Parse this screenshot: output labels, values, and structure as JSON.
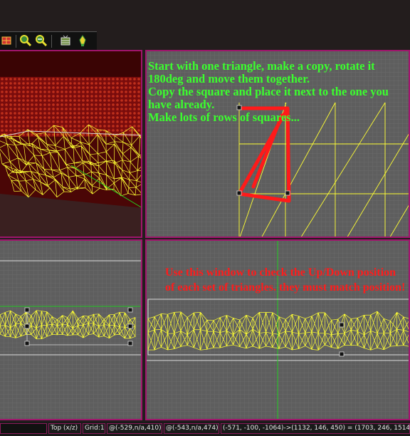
{
  "toolbar": {
    "buttons": [
      {
        "icon": "grid-tool-icon"
      },
      {
        "icon": "zoom-in-icon"
      },
      {
        "icon": "zoom-out-icon"
      },
      {
        "icon": "terrain-tool-icon"
      },
      {
        "icon": "light-bulb-icon"
      }
    ]
  },
  "viewports": {
    "top_right": {
      "instructions": "Start with one triangle, make a copy, rotate it 180deg and move them together.\nCopy the square and place it next to the one you have already.\nMake lots of rows of squares..."
    },
    "bottom_right": {
      "instructions": "Use this window to check the Up/Down position of each set of triangles. they must match position!"
    }
  },
  "statusbar": {
    "view": "Top (x/z)",
    "grid": "Grid:1",
    "coord1": "@(-529,n/a,410)",
    "coord2": "@(-543,n/a,474)",
    "selection": "(-571, -100, -1064)->(1132, 146, 450) = (1703, 246, 1514)"
  },
  "colors": {
    "viewport_border": "#a0156c",
    "wireframe": "#ffff33",
    "instruction_green": "#3bff2e",
    "instruction_red": "#ff1c1c"
  }
}
